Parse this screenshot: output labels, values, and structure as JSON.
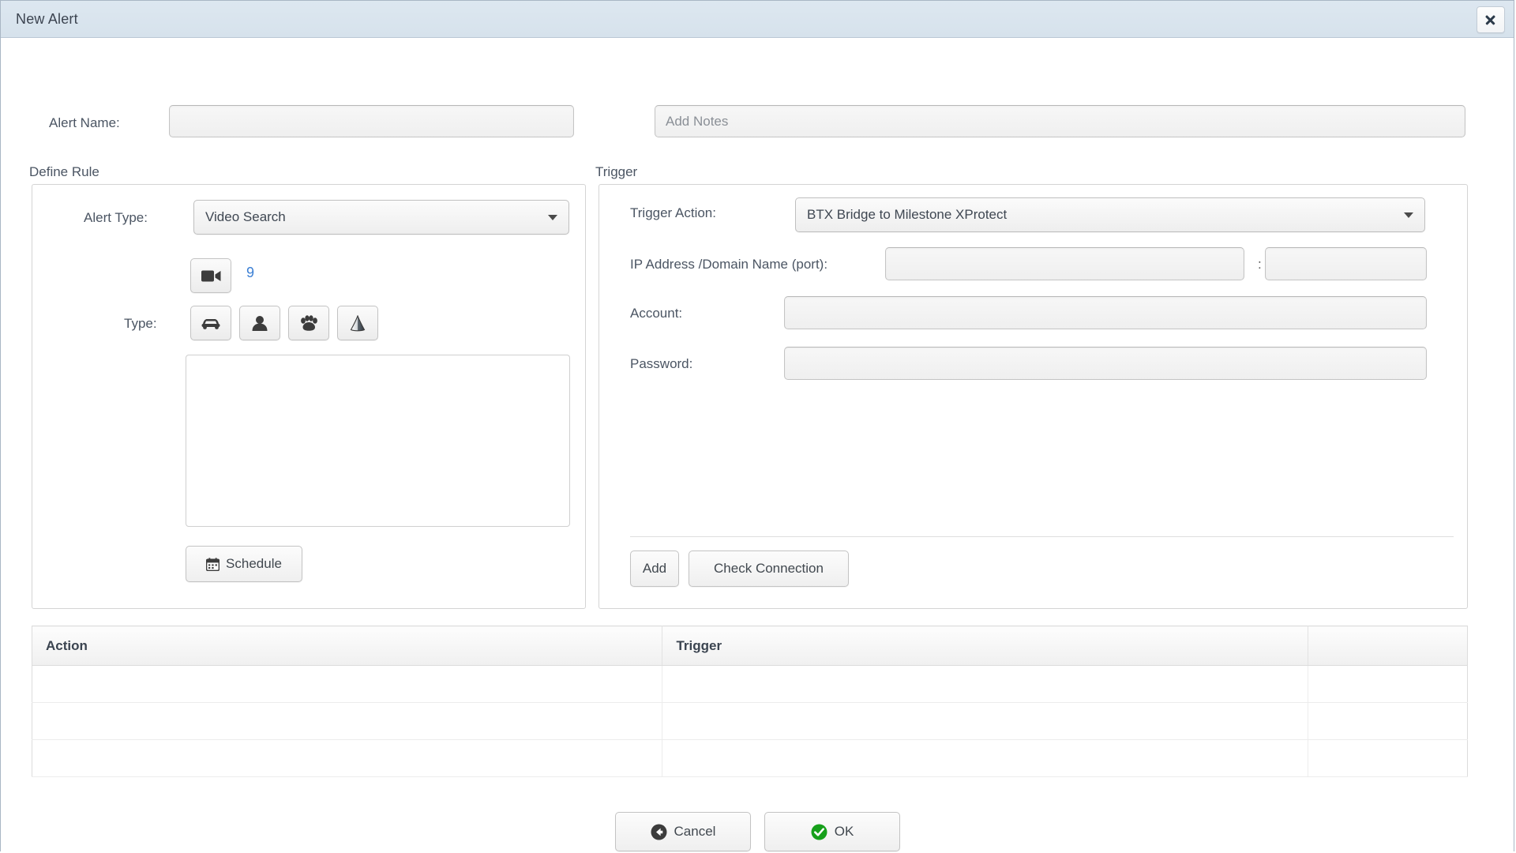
{
  "window": {
    "title": "New Alert",
    "close_icon": "close-icon"
  },
  "top_row": {
    "alert_name_label": "Alert Name:",
    "alert_name_value": "",
    "alert_name_placeholder": "",
    "notes_placeholder": "Add Notes",
    "notes_value": ""
  },
  "sections": {
    "define_rule_caption": "Define Rule",
    "trigger_caption": "Trigger"
  },
  "define_rule": {
    "alert_type_label": "Alert Type:",
    "alert_type_value": "Video Search",
    "alert_type_caret_icon": "chevron-down-icon",
    "camera_button_icon": "video-camera-icon",
    "camera_count": "9",
    "type_label": "Type:",
    "type_icons": [
      {
        "name": "car-icon",
        "title": "Vehicle"
      },
      {
        "name": "person-icon",
        "title": "Person"
      },
      {
        "name": "paw-icon",
        "title": "Animal"
      },
      {
        "name": "cone-icon",
        "title": "Object"
      }
    ],
    "list_items": [],
    "schedule_label": "Schedule",
    "schedule_icon": "calendar-icon"
  },
  "trigger": {
    "action_label": "Trigger Action:",
    "action_value": "BTX Bridge to Milestone XProtect",
    "action_caret_icon": "chevron-down-icon",
    "ip_label": "IP Address /Domain Name (port):",
    "ip_value": "",
    "port_separator": ":",
    "port_value": "",
    "account_label": "Account:",
    "account_value": "",
    "password_label": "Password:",
    "password_value": "",
    "add_label": "Add",
    "check_connection_label": "Check Connection"
  },
  "table": {
    "columns": [
      "Action",
      "Trigger",
      ""
    ],
    "rows": [
      [
        "",
        "",
        ""
      ],
      [
        "",
        "",
        ""
      ],
      [
        "",
        "",
        ""
      ]
    ]
  },
  "footer": {
    "cancel_label": "Cancel",
    "cancel_icon": "back-arrow-circle-icon",
    "ok_label": "OK",
    "ok_icon": "check-circle-icon"
  },
  "colors": {
    "titlebar": "#dde7f0",
    "accent_link": "#3b7fd4",
    "ok_green": "#17a01b",
    "cancel_dark": "#3c3c3c"
  }
}
